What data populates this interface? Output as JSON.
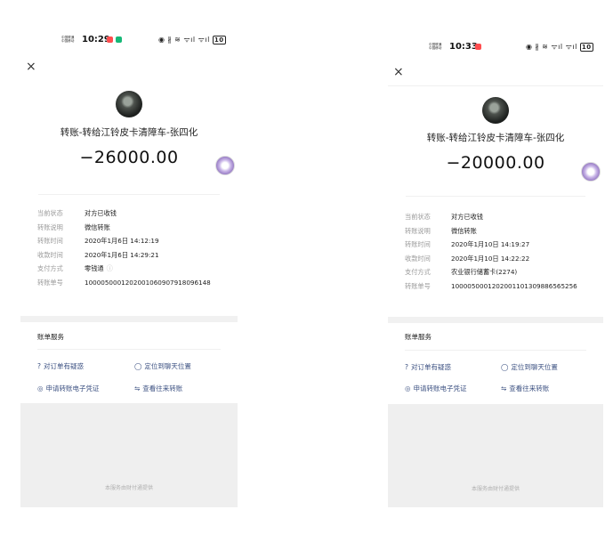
{
  "screens": [
    {
      "status": {
        "carrier": "中国联通\n中国移动",
        "time": "10:29",
        "battery": "10",
        "icons": "◉ ∦ ≋ ᯤıl ᯤıl"
      },
      "close_glyph": "×",
      "title": "转账-转给江铃皮卡清障车-张四化",
      "amount": "−26000.00",
      "details": [
        {
          "label": "当前状态",
          "value": "对方已收钱"
        },
        {
          "label": "转账说明",
          "value": "微信转账"
        },
        {
          "label": "转账时间",
          "value": "2020年1月6日 14:12:19"
        },
        {
          "label": "收款时间",
          "value": "2020年1月6日 14:29:21"
        },
        {
          "label": "支付方式",
          "value": "零钱通",
          "info": "ⓘ"
        },
        {
          "label": "转账单号",
          "value": "1000050001202001060907918096148"
        }
      ],
      "services": {
        "title": "账单服务",
        "items": [
          {
            "icon": "?",
            "label": "对订单有疑惑",
            "icon_name": "question-icon"
          },
          {
            "icon": "◯",
            "label": "定位到聊天位置",
            "icon_name": "chat-bubble-icon"
          },
          {
            "icon": "◎",
            "label": "申请转账电子凭证",
            "icon_name": "receipt-icon"
          },
          {
            "icon": "⇋",
            "label": "查看往来转账",
            "icon_name": "swap-icon"
          }
        ]
      },
      "footer_note": "本服务由财付通提供"
    },
    {
      "status": {
        "carrier": "中国联通\n中国移动",
        "time": "10:33",
        "battery": "10",
        "icons": "◉ ∦ ≋ ᯤıl ᯤıl"
      },
      "close_glyph": "×",
      "title": "转账-转给江铃皮卡清障车-张四化",
      "amount": "−20000.00",
      "details": [
        {
          "label": "当前状态",
          "value": "对方已收钱"
        },
        {
          "label": "转账说明",
          "value": "微信转账"
        },
        {
          "label": "转账时间",
          "value": "2020年1月10日 14:19:27"
        },
        {
          "label": "收款时间",
          "value": "2020年1月10日 14:22:22"
        },
        {
          "label": "支付方式",
          "value": "农业银行储蓄卡(2274)"
        },
        {
          "label": "转账单号",
          "value": "1000050001202001101309886565256"
        }
      ],
      "services": {
        "title": "账单服务",
        "items": [
          {
            "icon": "?",
            "label": "对订单有疑惑",
            "icon_name": "question-icon"
          },
          {
            "icon": "◯",
            "label": "定位到聊天位置",
            "icon_name": "chat-bubble-icon"
          },
          {
            "icon": "◎",
            "label": "申请转账电子凭证",
            "icon_name": "receipt-icon"
          },
          {
            "icon": "⇋",
            "label": "查看往来转账",
            "icon_name": "swap-icon"
          }
        ]
      },
      "footer_note": "本服务由财付通提供"
    }
  ]
}
